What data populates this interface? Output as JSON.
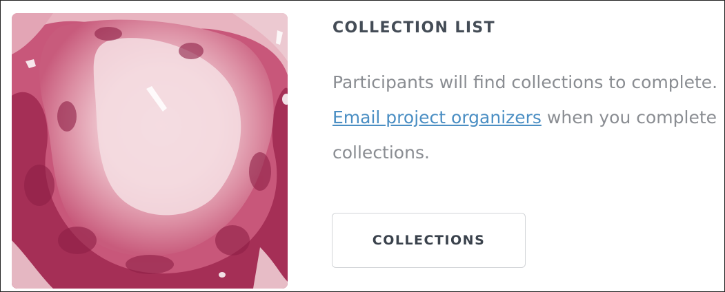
{
  "card": {
    "title": "COLLECTION LIST",
    "description": {
      "before": "Participants will find collections to complete. ",
      "link": "Email project organizers",
      "after": " when you complete collections."
    },
    "button": "COLLECTIONS"
  },
  "image": {
    "subject": "histology-tissue-slide"
  },
  "colors": {
    "title": "#444c56",
    "body_text": "#8a8d92",
    "link": "#4a8ec3",
    "button_border": "#d2d4d7",
    "tissue_dark": "#a52f56",
    "tissue_light": "#f0d4da"
  }
}
